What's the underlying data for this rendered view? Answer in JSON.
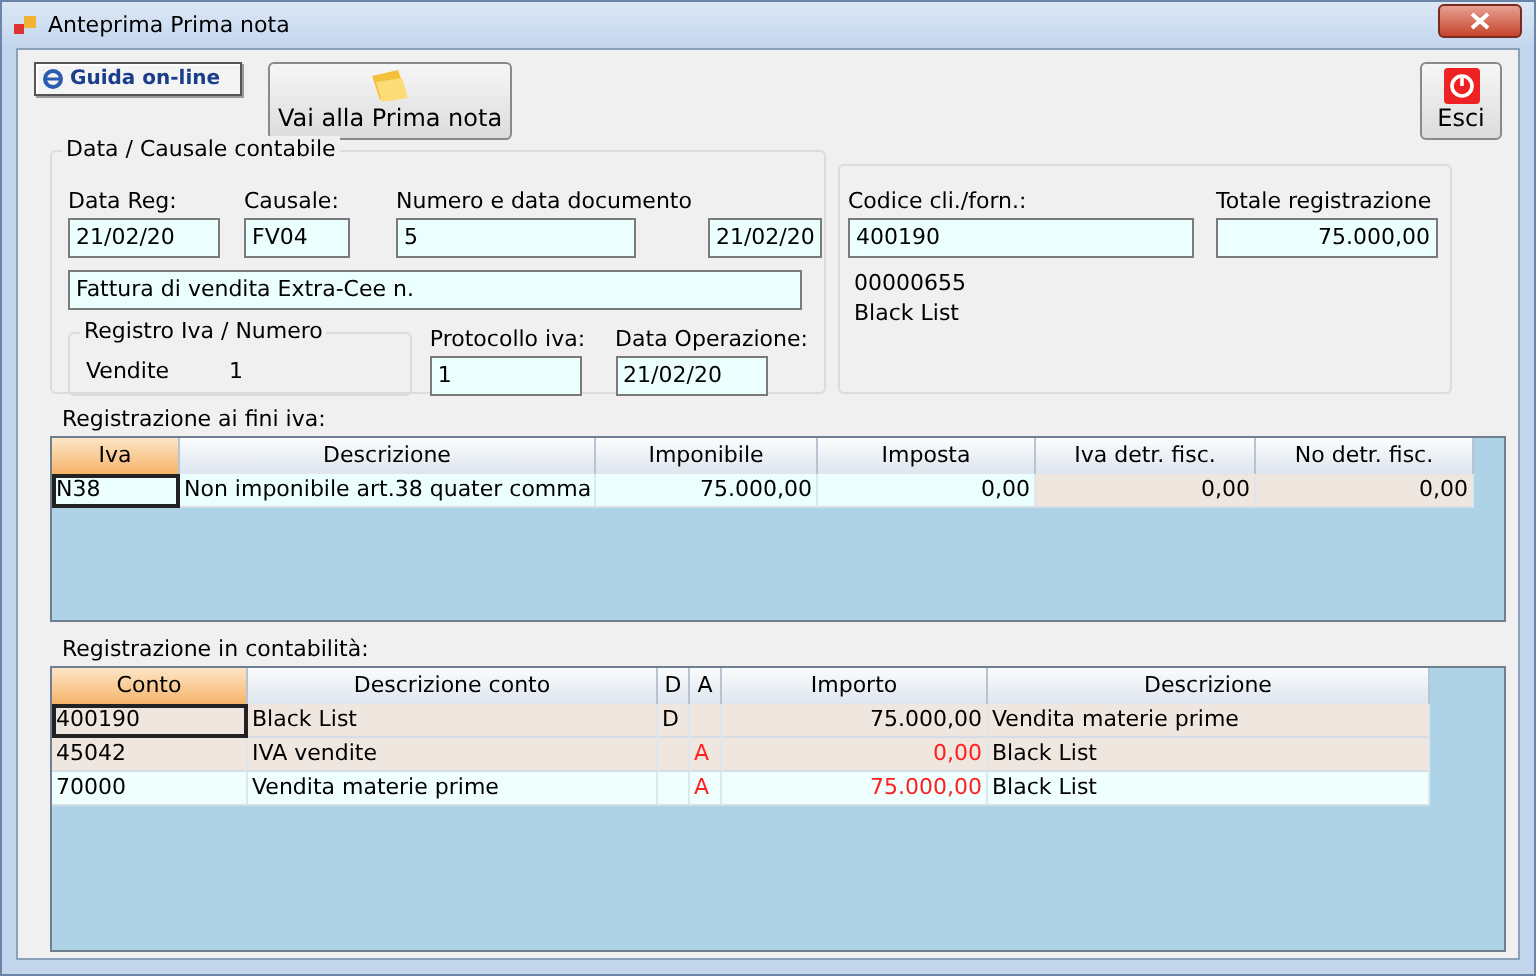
{
  "window": {
    "title": "Anteprima Prima nota"
  },
  "toolbar": {
    "help_button": "Guida on-line",
    "goto_button": "Vai alla Prima nota",
    "exit_button": "Esci"
  },
  "causale_group": {
    "title": "Data / Causale contabile",
    "fields": [
      {
        "label": "Data Reg:",
        "value": "21/02/20"
      },
      {
        "label": "Causale:",
        "value": "FV04"
      },
      {
        "label": "Numero e data documento",
        "value": "5"
      },
      {
        "value": "21/02/20"
      }
    ],
    "description": "Fattura di vendita Extra-Cee n.",
    "registro": {
      "title": "Registro Iva / Numero",
      "name": "Vendite",
      "number": "1"
    },
    "protocollo": {
      "label": "Protocollo iva:",
      "value": "1"
    },
    "data_operazione": {
      "label": "Data Operazione:",
      "value": "21/02/20"
    }
  },
  "cliente_group": {
    "code_label": "Codice cli./forn.:",
    "code": "400190",
    "total_label": "Totale registrazione",
    "total": "75.000,00",
    "number": "00000655",
    "name": "Black List"
  },
  "iva_table": {
    "title": "Registrazione ai fini iva:",
    "columns": [
      {
        "label": "Iva",
        "selected": true
      },
      {
        "label": "Descrizione",
        "selected": false
      },
      {
        "label": "Imponibile",
        "selected": false
      },
      {
        "label": "Imposta",
        "selected": false
      },
      {
        "label": "Iva detr. fisc.",
        "selected": false
      },
      {
        "label": "No detr. fisc.",
        "selected": false
      }
    ],
    "rows": [
      {
        "selected": true,
        "cells": [
          "N38",
          "Non imponibile art.38 quater comma",
          "75.000,00",
          "0,00",
          "0,00",
          "0,00"
        ]
      }
    ]
  },
  "conti_table": {
    "title": "Registrazione in contabilità:",
    "columns": [
      {
        "label": "Conto",
        "selected": true
      },
      {
        "label": "Descrizione conto",
        "selected": false
      },
      {
        "label": "D",
        "selected": false
      },
      {
        "label": "A",
        "selected": false
      },
      {
        "label": "Importo",
        "selected": false
      },
      {
        "label": "Descrizione",
        "selected": false
      }
    ],
    "rows": [
      {
        "selected": true,
        "color": "#efe6df",
        "conto": "400190",
        "descrizione_conto": "Black List",
        "side": "D",
        "importo": "75.000,00",
        "descrizione": "Vendita materie prime"
      },
      {
        "selected": false,
        "color": "#efe6df",
        "conto": "45042",
        "descrizione_conto": "IVA vendite",
        "side": "A",
        "importo": "0,00",
        "descrizione": "Black List"
      },
      {
        "selected": false,
        "color": "#effffe",
        "conto": "70000",
        "descrizione_conto": "Vendita materie prime",
        "side": "A",
        "importo": "75.000,00",
        "descrizione": "Black List"
      }
    ]
  }
}
